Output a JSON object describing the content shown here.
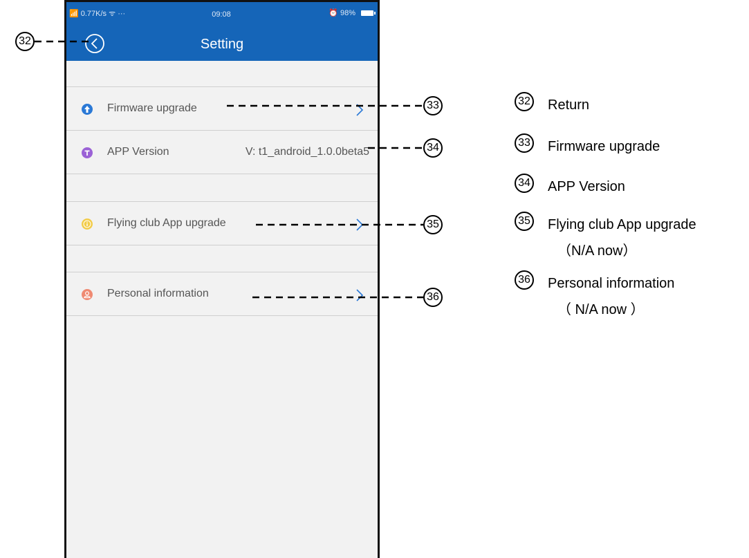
{
  "status_bar": {
    "left": "📶 0.77K/s ᯤ ···",
    "time": "09:08",
    "right": "⏰ 98%"
  },
  "header": {
    "title": "Setting"
  },
  "settings": {
    "firmware": {
      "label": "Firmware upgrade",
      "icon": "arrow-up-icon",
      "color": "#2b79d6"
    },
    "app_version": {
      "label": "APP Version",
      "value": "V: t1_android_1.0.0beta5",
      "icon": "t-icon",
      "color": "#9b62d6"
    },
    "flying_club": {
      "label": "Flying club App upgrade",
      "icon": "info-icon",
      "color": "#f2cc4a"
    },
    "personal": {
      "label": "Personal information",
      "icon": "person-icon",
      "color": "#ef8a72"
    }
  },
  "callouts": {
    "n32": "32",
    "n33": "33",
    "n34": "34",
    "n35": "35",
    "n36": "36"
  },
  "legend": {
    "items": [
      {
        "num": "32",
        "text": "Return",
        "sub": ""
      },
      {
        "num": "33",
        "text": "Firmware upgrade",
        "sub": ""
      },
      {
        "num": "34",
        "text": "APP Version",
        "sub": ""
      },
      {
        "num": "35",
        "text": "Flying club App upgrade",
        "sub": "（N/A now）"
      },
      {
        "num": "36",
        "text": "Personal information",
        "sub": "（ N/A now ）"
      }
    ]
  },
  "colors": {
    "app_bar": "#1565b8",
    "chevron": "#2b79d6",
    "background": "#f2f2f2"
  }
}
